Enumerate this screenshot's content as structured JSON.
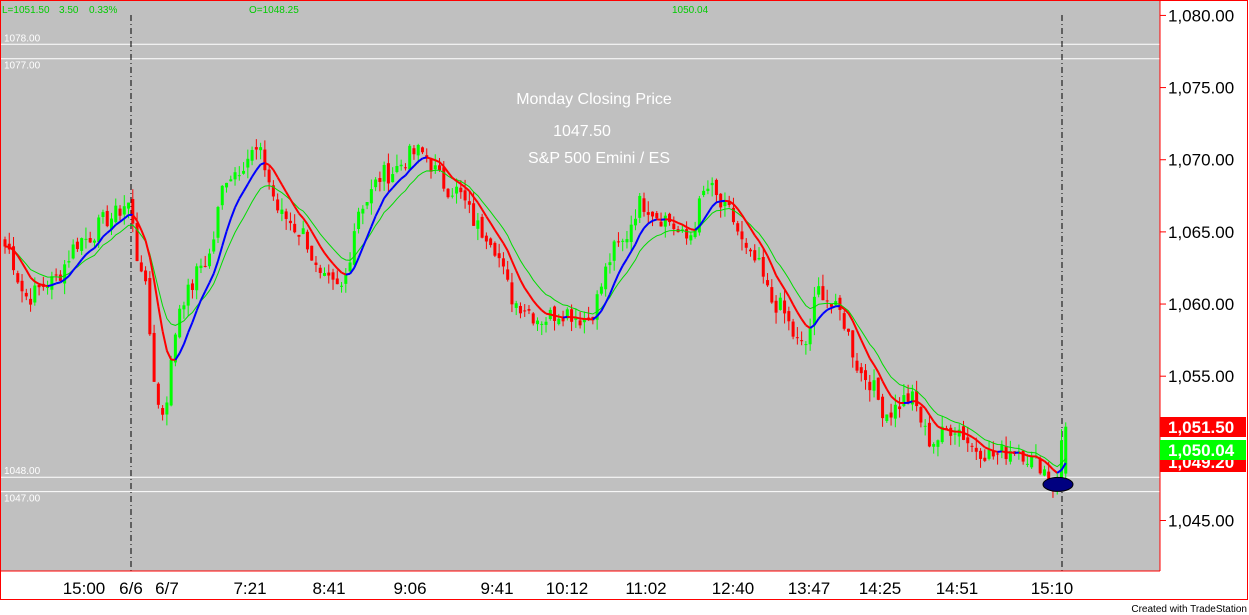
{
  "header": {
    "last": "L=1051.50",
    "change": "3.50",
    "change_pct": "0.33%",
    "open": "O=1048.25",
    "cursor_value": "1050.04"
  },
  "annotation": {
    "line1": "Monday Closing Price",
    "line2": "1047.50",
    "line3": "S&P 500 Emini / ES"
  },
  "hlines": [
    {
      "label": "1078.00",
      "value": 1078.0
    },
    {
      "label": "1077.00",
      "value": 1077.0
    },
    {
      "label": "1048.00",
      "value": 1048.0
    },
    {
      "label": "1047.00",
      "value": 1047.0
    }
  ],
  "price_tags": [
    {
      "label": "1,051.50",
      "value": 1051.5,
      "color": "#ff0000",
      "text_color": "#ffffff"
    },
    {
      "label": "1,050.04",
      "value": 1050.04,
      "color": "#00ff00",
      "text_color": "#ffffff"
    },
    {
      "label": "1,049.20",
      "value": 1049.2,
      "color": "#ff0000",
      "text_color": "#ffffff"
    }
  ],
  "colors": {
    "background": "#c0c0c0",
    "up": "#00ff00",
    "down": "#ff0000",
    "ma_fast_up": "#0000ff",
    "ma_fast_down": "#ff0000",
    "ma_slow": "#00dd00",
    "axis": "#ff0000",
    "marker": "#000080"
  },
  "chart_data": {
    "type": "candlestick",
    "title": "",
    "y_ticks": [
      "1,080.00",
      "1,075.00",
      "1,070.00",
      "1,065.00",
      "1,060.00",
      "1,055.00",
      "1,050.00",
      "1,045.00"
    ],
    "y_tick_values": [
      1080,
      1075,
      1070,
      1065,
      1060,
      1055,
      1050,
      1045
    ],
    "ylim": [
      1041.5,
      1081.0
    ],
    "x_ticks": [
      "15:00",
      "6/6",
      "6/7",
      "7:21",
      "8:41",
      "9:06",
      "9:41",
      "10:12",
      "11:02",
      "12:40",
      "13:47",
      "14:25",
      "14:51",
      "15:10"
    ],
    "session_breaks": [
      "6/6",
      "15:10"
    ],
    "anchors": [
      {
        "t": 0,
        "p": 1064.0
      },
      {
        "t": 0.02,
        "p": 1060.5
      },
      {
        "t": 0.04,
        "p": 1061.5
      },
      {
        "t": 0.07,
        "p": 1064.5
      },
      {
        "t": 0.095,
        "p": 1066.0
      },
      {
        "t": 0.11,
        "p": 1067.0
      },
      {
        "t": 0.12,
        "p": 1063.0
      },
      {
        "t": 0.14,
        "p": 1052.5
      },
      {
        "t": 0.16,
        "p": 1060.5
      },
      {
        "t": 0.18,
        "p": 1063.0
      },
      {
        "t": 0.2,
        "p": 1069.0
      },
      {
        "t": 0.225,
        "p": 1070.5
      },
      {
        "t": 0.25,
        "p": 1066.0
      },
      {
        "t": 0.265,
        "p": 1065.0
      },
      {
        "t": 0.285,
        "p": 1061.5
      },
      {
        "t": 0.3,
        "p": 1061.0
      },
      {
        "t": 0.32,
        "p": 1067.0
      },
      {
        "t": 0.34,
        "p": 1069.0
      },
      {
        "t": 0.37,
        "p": 1070.5
      },
      {
        "t": 0.4,
        "p": 1068.0
      },
      {
        "t": 0.43,
        "p": 1065.0
      },
      {
        "t": 0.46,
        "p": 1060.0
      },
      {
        "t": 0.48,
        "p": 1059.0
      },
      {
        "t": 0.5,
        "p": 1059.5
      },
      {
        "t": 0.52,
        "p": 1059.0
      },
      {
        "t": 0.55,
        "p": 1064.0
      },
      {
        "t": 0.57,
        "p": 1067.0
      },
      {
        "t": 0.59,
        "p": 1066.0
      },
      {
        "t": 0.61,
        "p": 1064.5
      },
      {
        "t": 0.63,
        "p": 1068.0
      },
      {
        "t": 0.645,
        "p": 1066.5
      },
      {
        "t": 0.67,
        "p": 1063.0
      },
      {
        "t": 0.69,
        "p": 1060.0
      },
      {
        "t": 0.715,
        "p": 1057.0
      },
      {
        "t": 0.73,
        "p": 1061.0
      },
      {
        "t": 0.745,
        "p": 1059.5
      },
      {
        "t": 0.77,
        "p": 1055.0
      },
      {
        "t": 0.79,
        "p": 1052.5
      },
      {
        "t": 0.81,
        "p": 1053.5
      },
      {
        "t": 0.83,
        "p": 1050.5
      },
      {
        "t": 0.85,
        "p": 1051.5
      },
      {
        "t": 0.87,
        "p": 1050.0
      },
      {
        "t": 0.885,
        "p": 1049.5
      },
      {
        "t": 0.905,
        "p": 1050.0
      },
      {
        "t": 0.925,
        "p": 1049.0
      },
      {
        "t": 0.94,
        "p": 1047.5
      },
      {
        "t": 0.95,
        "p": 1051.5
      }
    ]
  },
  "footer": "Created with TradeStation"
}
